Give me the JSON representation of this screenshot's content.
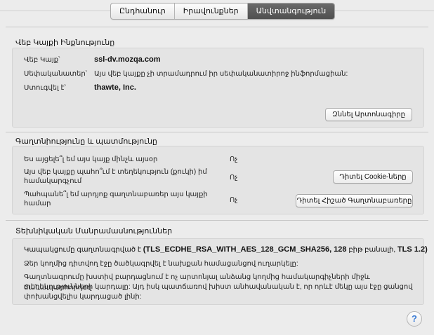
{
  "tabs": [
    {
      "label": "Ընդհանուր"
    },
    {
      "label": "Իրավունքներ"
    },
    {
      "label": "Անվտանգություն"
    }
  ],
  "website_identity": {
    "title": "Վեբ Կայքի Ինքնությունը",
    "website_label": "Վեբ Կայք՝",
    "website_value": "ssl-dv.mozqa.com",
    "owner_label": "Սեփականատեր՝",
    "owner_value": "Այս վեբ կայքը չի տրամադրում իր սեփականատիրոջ ինֆորմացիան:",
    "verified_label": "Ստուգվել է՝",
    "verified_value": "thawte, Inc.",
    "view_certificate_button": "Զննել Արտոնագիրը"
  },
  "privacy_history": {
    "title": "Գաղտնիությունը և պատմությունը",
    "rows": [
      {
        "question": "Ես այցելե՞լ եմ այս կայք մինչև այսօր",
        "answer": "Ոչ"
      },
      {
        "question_line1": "Այս վեբ կայքը պահո՞ւմ է տեղեկություն (քուկի) իմ",
        "question_line2": "համակարգչում",
        "answer": "Ոչ",
        "button": "Դիտել Cookie-ները"
      },
      {
        "question_line1": "Պահպանե՞լ եմ արդյոք գաղտնաբառեր այս կայքի",
        "question_line2": "համար",
        "answer": "Ոչ",
        "button": "Դիտել Հիշած Գաղտնաբառերը"
      }
    ]
  },
  "technical_details": {
    "title": "Տեխնիկական Մանրամասնություններ",
    "connection_prefix": "Կապակցումը գաղտնագրված է",
    "connection_cipher": "(TLS_ECDHE_RSA_WITH_AES_128_GCM_SHA256, 128",
    "connection_bit": "բիթ",
    "connection_keys": "բանալի,",
    "connection_tls": "TLS 1.2)",
    "line2": "Ձեր կողմից դիտվող էջը ծածկագրվել է նախքան համացանցով ուղարկելը:",
    "line3": "Գաղտնագրումը խստիվ բարդացնում է ոչ արտոնյալ անձանց կողմից համակարգիչների միջև ճանապարհորդող",
    "line4": "տեղեկությունների կարդալը: Այդ իսկ պատճառով խիստ անհավանական է, որ որևէ մեկը այս էջը ցանցով",
    "line5": "փոխանցվելիս կարդացած լինի:"
  },
  "help_button": "?"
}
